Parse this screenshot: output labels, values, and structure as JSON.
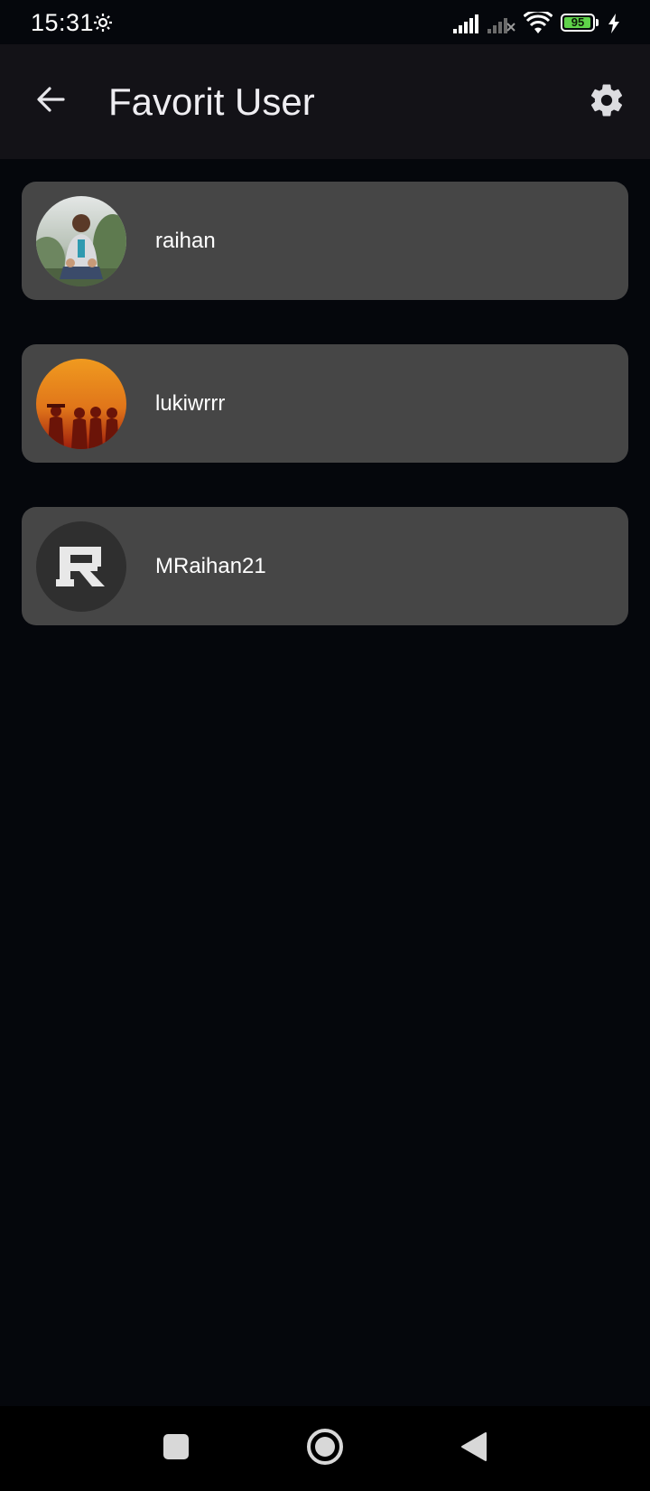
{
  "status_bar": {
    "time": "15:31",
    "battery_level": "95",
    "battery_fraction": 0.95,
    "icons": [
      "settings-gear-icon",
      "cell-signal-icon",
      "cell-signal-no-service-icon",
      "wifi-icon",
      "battery-icon",
      "charging-bolt-icon"
    ]
  },
  "app_bar": {
    "title": "Favorit User",
    "back_icon": "arrow-back-icon",
    "settings_icon": "gear-icon"
  },
  "users": [
    {
      "name": "raihan",
      "avatar": "photo-person-outdoors"
    },
    {
      "name": "lukiwrrr",
      "avatar": "photo-orange-group"
    },
    {
      "name": "MRaihan21",
      "avatar": "logo-letter-r"
    }
  ],
  "nav_bar": {
    "icons": [
      "recents-square-icon",
      "home-circle-icon",
      "back-triangle-icon"
    ]
  },
  "colors": {
    "background": "#05070c",
    "app_bar": "#131217",
    "card": "#464646",
    "text": "#ffffff",
    "battery_fill": "#5fd34a"
  }
}
